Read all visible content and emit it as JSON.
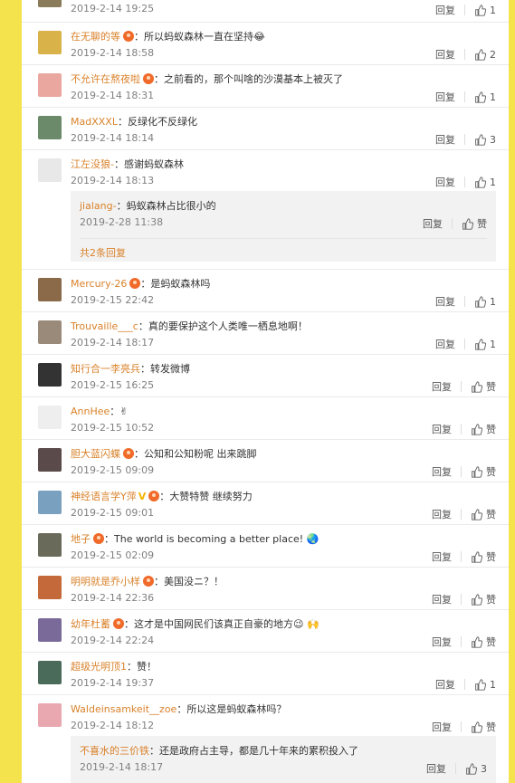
{
  "labels": {
    "reply": "回复",
    "like": "赞",
    "sep": "："
  },
  "comments": [
    {
      "user": "",
      "text": "",
      "time": "2019-2-14 19:25",
      "likes": "1",
      "avatar_color": "#8a7b5a"
    },
    {
      "user": "在无聊的等",
      "text": "所以蚂蚁森林一直在坚持😂",
      "time": "2019-2-14 18:58",
      "likes": "2",
      "avatar_color": "#d9b34a"
    },
    {
      "user": "不允许在熬夜啦",
      "text": "之前看的，那个叫啥的沙漠基本上被灭了",
      "time": "2019-2-14 18:31",
      "likes": "1",
      "avatar_color": "#e9a7a0"
    },
    {
      "user": "MadXXXL",
      "text": "反绿化不反绿化",
      "time": "2019-2-14 18:14",
      "likes": "3",
      "avatar_color": "#6a8a6a"
    },
    {
      "user": "江左没狼-",
      "text": "感谢蚂蚁森林",
      "time": "2019-2-14 18:13",
      "likes": "1",
      "avatar_color": "#e8e8e8"
    },
    {
      "user": "Mercury-26",
      "text": "是蚂蚁森林吗",
      "time": "2019-2-15 22:42",
      "likes": "1",
      "avatar_color": "#8b6a4a"
    },
    {
      "user": "Trouvaille___c",
      "text": "真的要保护这个人类唯一栖息地啊！",
      "time": "2019-2-14 18:17",
      "likes": "1",
      "avatar_color": "#9a8a7a"
    },
    {
      "user": "知行合一李亮兵",
      "text": "转发微博",
      "time": "2019-2-15 16:25",
      "likes": "赞",
      "avatar_color": "#333333"
    },
    {
      "user": "AnnHee",
      "text": "✌",
      "time": "2019-2-15 10:52",
      "likes": "赞",
      "avatar_color": "#eeeeee"
    },
    {
      "user": "胆大蓝闪蝶",
      "text": "公知和公知粉呢  出来跳脚",
      "time": "2019-2-15 09:09",
      "likes": "赞",
      "avatar_color": "#5a4a4a"
    },
    {
      "user": "神经语言学Y萍",
      "text": "大赞特赞  继续努力",
      "time": "2019-2-15 09:01",
      "likes": "赞",
      "avatar_color": "#7aa0c0"
    },
    {
      "user": "地子",
      "text": "The world is becoming a better place! 🌏",
      "time": "2019-2-15 02:09",
      "likes": "赞",
      "avatar_color": "#6a6a5a"
    },
    {
      "user": "明明就是乔小样",
      "text": "美国没ニ？！",
      "time": "2019-2-14 22:36",
      "likes": "赞",
      "avatar_color": "#c46a3a"
    },
    {
      "user": "幼年杜蓄",
      "text": "这才是中国网民们该真正自豪的地方😉 🙌",
      "time": "2019-2-14 22:24",
      "likes": "赞",
      "avatar_color": "#7a6a9a"
    },
    {
      "user": "超级光明顶1",
      "text": "赞！",
      "time": "2019-2-14 19:37",
      "likes": "1",
      "avatar_color": "#4a6a5a"
    },
    {
      "user": "Waldeinsamkeit__zoe",
      "text": "所以这是蚂蚁森林吗？",
      "time": "2019-2-14 18:12",
      "likes": "赞",
      "avatar_color": "#e9a7b0"
    }
  ],
  "replies": {
    "r1": {
      "user": "jialang-",
      "text": "蚂蚁森林占比很小的",
      "time": "2019-2-28 11:38",
      "likes": "赞",
      "more": "共2条回复"
    },
    "r2": {
      "user": "不喜水的三价铁",
      "text": "还是政府占主导，都是几十年来的累积投入了",
      "time": "2019-2-14 18:17",
      "likes": "3"
    }
  },
  "colors": {
    "background_yellow": "#f5e34d",
    "username": "#d9822b",
    "time": "#808080"
  }
}
